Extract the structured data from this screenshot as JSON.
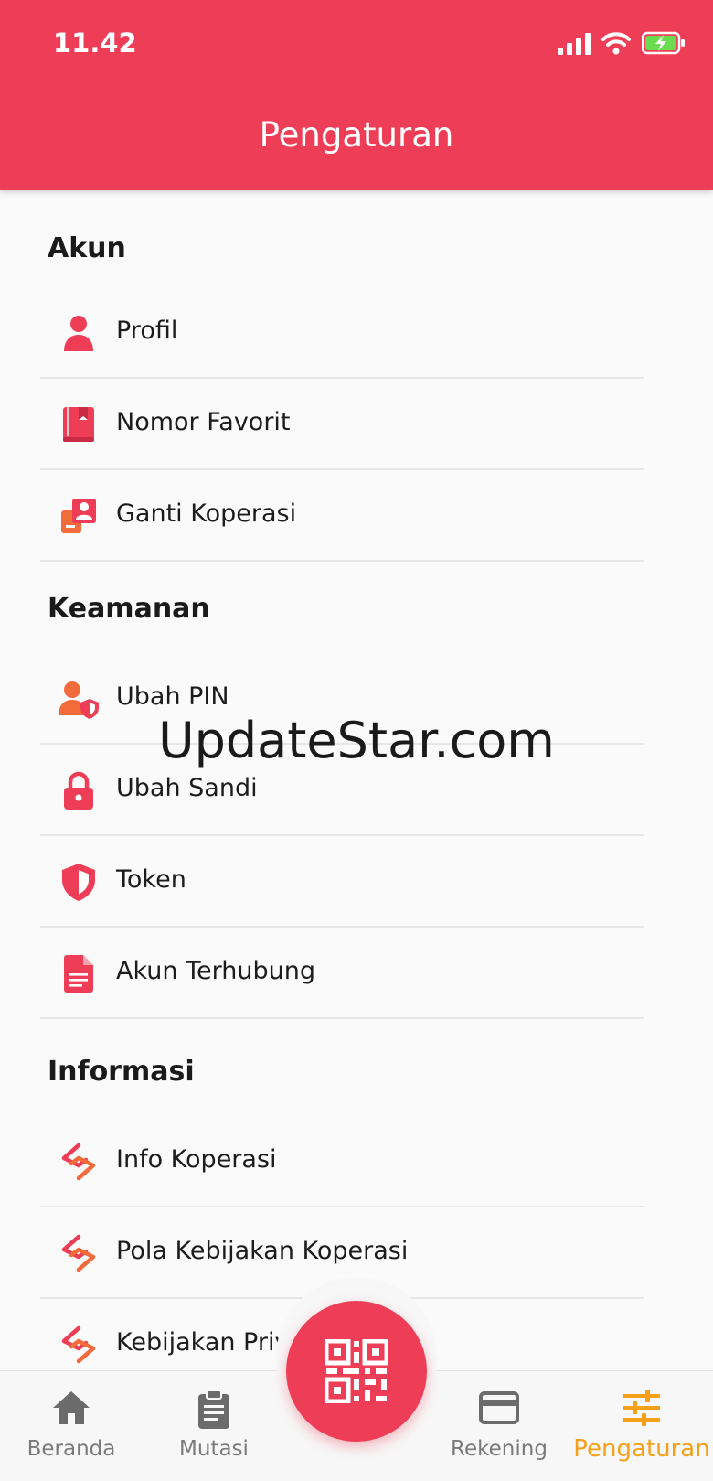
{
  "status_bar": {
    "time": "11.42"
  },
  "header": {
    "title": "Pengaturan"
  },
  "sections": [
    {
      "title": "Akun",
      "items": [
        {
          "label": "Profil",
          "icon": "person-icon"
        },
        {
          "label": "Nomor Favorit",
          "icon": "book-icon"
        },
        {
          "label": "Ganti Koperasi",
          "icon": "switch-account-icon"
        }
      ]
    },
    {
      "title": "Keamanan",
      "items": [
        {
          "label": "Ubah PIN",
          "icon": "user-shield-icon"
        },
        {
          "label": "Ubah Sandi",
          "icon": "lock-icon"
        },
        {
          "label": "Token",
          "icon": "shield-icon"
        },
        {
          "label": "Akun Terhubung",
          "icon": "document-icon"
        }
      ]
    },
    {
      "title": "Informasi",
      "items": [
        {
          "label": "Info Koperasi",
          "icon": "koperasi-logo-icon"
        },
        {
          "label": "Pola Kebijakan Koperasi",
          "icon": "koperasi-logo-icon"
        },
        {
          "label": "Kebijakan Privasi",
          "icon": "koperasi-logo-icon"
        }
      ]
    }
  ],
  "watermark": "UpdateStar.com",
  "bottom_nav": {
    "items": [
      {
        "label": "Beranda",
        "icon": "home-icon",
        "active": false
      },
      {
        "label": "Mutasi",
        "icon": "clipboard-icon",
        "active": false
      },
      {
        "label": "Rekening",
        "icon": "card-icon",
        "active": false
      },
      {
        "label": "Pengaturan",
        "icon": "sliders-icon",
        "active": true
      }
    ],
    "center_button_icon": "qr-code-icon"
  },
  "colors": {
    "primary": "#ee3e57",
    "accent_orange": "#f26b3a",
    "active_nav": "#f5a01a",
    "inactive_nav": "#6b6b6b"
  }
}
